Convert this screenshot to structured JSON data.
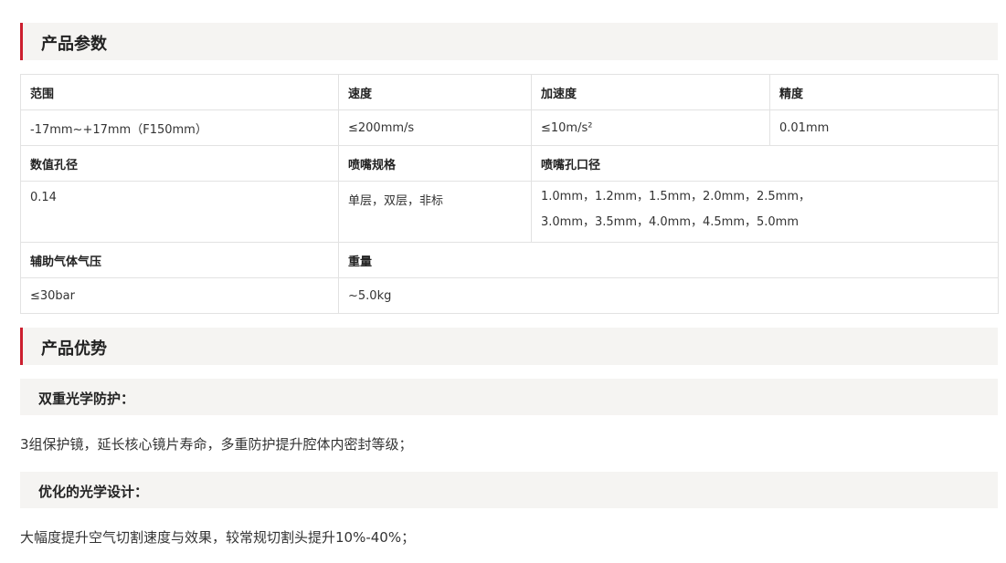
{
  "params_section": {
    "title": "产品参数",
    "rows": [
      {
        "labels": [
          "范围",
          "速度",
          "加速度",
          "精度"
        ]
      },
      {
        "values": [
          "-17mm~+17mm（F150mm）",
          "≤200mm/s",
          "≤10m/s²",
          "0.01mm"
        ]
      },
      {
        "labels": [
          "数值孔径",
          "喷嘴规格",
          "喷嘴孔口径"
        ]
      },
      {
        "values": [
          "0.14",
          "单层，双层，非标"
        ],
        "multi_value": [
          "1.0mm，1.2mm，1.5mm，2.0mm，2.5mm，",
          "3.0mm，3.5mm，4.0mm，4.5mm，5.0mm"
        ]
      },
      {
        "labels": [
          "辅助气体气压",
          "重量"
        ]
      },
      {
        "values": [
          "≤30bar",
          "~5.0kg"
        ]
      }
    ]
  },
  "advantages_section": {
    "title": "产品优势",
    "items": [
      {
        "heading": "双重光学防护：",
        "text": "3组保护镜，延长核心镜片寿命，多重防护提升腔体内密封等级；"
      },
      {
        "heading": "优化的光学设计：",
        "text": "大幅度提升空气切割速度与效果，较常规切割头提升10%-40%；"
      }
    ]
  },
  "colors": {
    "accent": "#cc1f2f",
    "header_bg": "#f5f4f2",
    "border": "#e2e2e2"
  }
}
